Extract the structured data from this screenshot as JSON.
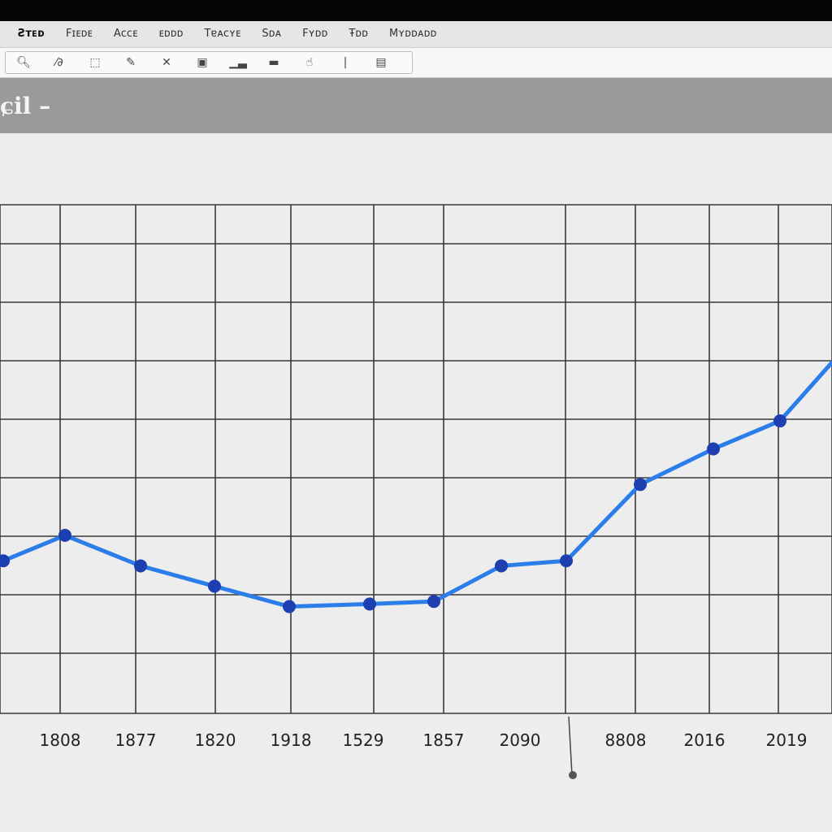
{
  "window": {
    "menu": [
      "Ƨᴛᴇᴅ",
      "Fɪᴇᴅᴇ",
      "Aᴄᴄᴇ",
      "ᴇᴅᴅᴅ",
      "Tɐᴀᴄʏᴇ",
      "Sᴅᴀ",
      "Fʏᴅᴅ",
      "Ŧᴅᴅ",
      "Mʏᴅᴅᴀᴅᴅ"
    ],
    "toolbar_icons": [
      "zoom-icon",
      "pan-icon",
      "select-icon",
      "brush-icon",
      "edit-icon",
      "image-icon",
      "chart-icon",
      "folder-icon",
      "move-icon",
      "text-cursor-icon",
      "layers-icon"
    ]
  },
  "header": {
    "title": "ɕil –"
  },
  "chart_data": {
    "type": "line",
    "title": "",
    "xlabel": "",
    "ylabel": "",
    "grid": true,
    "color": "#2b7de9",
    "marker_color": "#1d3fb0",
    "categories": [
      "1808",
      "1877",
      "1820",
      "1918",
      "1529",
      "1857",
      "2090",
      "",
      "8808",
      "2016",
      "2019"
    ],
    "series": [
      {
        "values": [
          3.0,
          3.5,
          2.9,
          2.5,
          2.1,
          2.15,
          2.2,
          2.9,
          3.0,
          4.5,
          5.2,
          5.75,
          6.9
        ]
      }
    ]
  }
}
